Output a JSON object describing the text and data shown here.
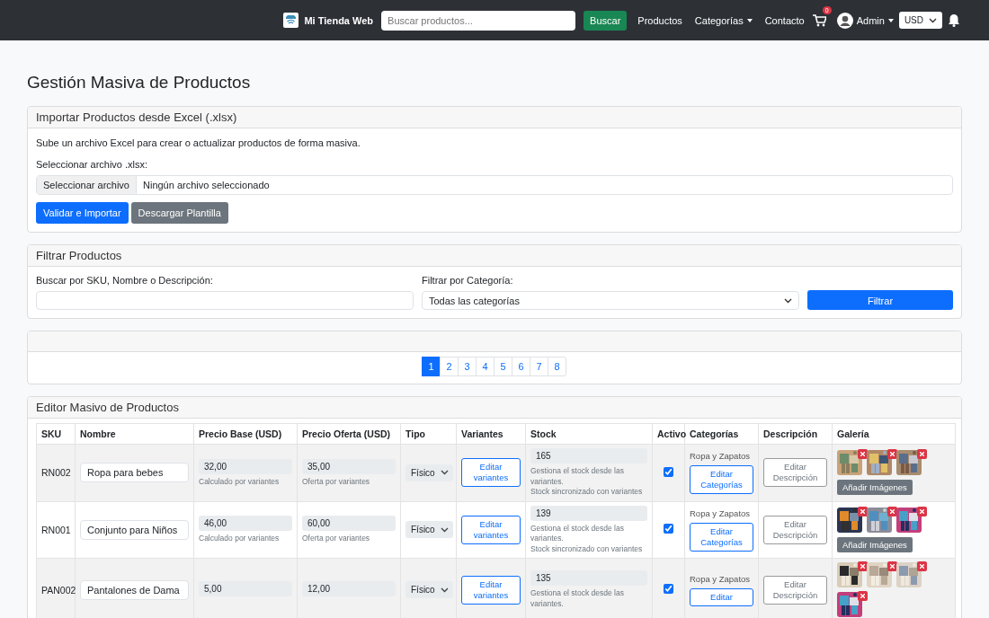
{
  "navbar": {
    "brand": "Mi Tienda Web",
    "search_placeholder": "Buscar productos...",
    "search_button": "Buscar",
    "links": [
      {
        "label": "Productos",
        "dropdown": false
      },
      {
        "label": "Categorías",
        "dropdown": true
      },
      {
        "label": "Contacto",
        "dropdown": false
      }
    ],
    "cart_count": "0",
    "user": "Admin",
    "currency": "USD"
  },
  "page_title": "Gestión Masiva de Productos",
  "import_card": {
    "title": "Importar Productos desde Excel (.xlsx)",
    "description": "Sube un archivo Excel para crear o actualizar productos de forma masiva.",
    "file_label": "Seleccionar archivo .xlsx:",
    "file_button": "Seleccionar archivo",
    "file_status": "Ningún archivo seleccionado",
    "buttons": [
      {
        "label": "Validar e Importar",
        "kind": "primary"
      },
      {
        "label": "Descargar Plantilla",
        "kind": "secondary"
      }
    ]
  },
  "filter_card": {
    "title": "Filtrar Productos",
    "search_label": "Buscar por SKU, Nombre o Descripción:",
    "category_label": "Filtrar por Categoría:",
    "category_value": "Todas las categorías",
    "button": "Filtrar"
  },
  "pagination": [
    {
      "label": "1",
      "selected": true
    },
    {
      "label": "2",
      "selected": false
    },
    {
      "label": "3",
      "selected": false
    },
    {
      "label": "4",
      "selected": false
    },
    {
      "label": "5",
      "selected": false
    },
    {
      "label": "6",
      "selected": false
    },
    {
      "label": "7",
      "selected": false
    },
    {
      "label": "8",
      "selected": false
    }
  ],
  "editor": {
    "title": "Editor Masivo de Productos",
    "columns": [
      "SKU",
      "Nombre",
      "Precio Base (USD)",
      "Precio Oferta (USD)",
      "Tipo",
      "Variantes",
      "Stock",
      "Activo",
      "Categorías",
      "Descripción",
      "Galería"
    ],
    "rows": [
      {
        "sku": "RN002",
        "name": "Ropa para bebes",
        "base_price": "32,00",
        "base_hint": "Calculado por variantes",
        "offer_price": "35,00",
        "offer_hint": "Oferta por variantes",
        "type": "Físico",
        "variants_button": "Editar variantes",
        "stock": "165",
        "stock_notes": [
          "Gestiona el stock desde las variantes.",
          "Stock sincronizado con variantes"
        ],
        "active": true,
        "categories": "Ropa y Zapatos",
        "categories_button": "Editar Categorías",
        "description_button": "Editar Descripción",
        "gallery": [
          {
            "kind": "picture"
          },
          {
            "kind": "picture"
          },
          {
            "kind": "picture"
          }
        ],
        "add_images_button": "Añadir Imágenes"
      },
      {
        "sku": "RN001",
        "name": "Conjunto para Niños",
        "base_price": "46,00",
        "base_hint": "Calculado por variantes",
        "offer_price": "60,00",
        "offer_hint": "Oferta por variantes",
        "type": "Físico",
        "variants_button": "Editar variantes",
        "stock": "139",
        "stock_notes": [
          "Gestiona el stock desde las variantes.",
          "Stock sincronizado con variantes"
        ],
        "active": true,
        "categories": "Ropa y Zapatos",
        "categories_button": "Editar Categorías",
        "description_button": "Editar Descripción",
        "gallery": [
          {
            "kind": "picture"
          },
          {
            "kind": "picture"
          },
          {
            "kind": "picture"
          }
        ],
        "add_images_button": "Añadir Imágenes"
      },
      {
        "sku": "PAN002",
        "name": "Pantalones de Dama",
        "base_price": "5,00",
        "offer_price": "12,00",
        "type": "Físico",
        "variants_button": "Editar variantes",
        "stock": "135",
        "stock_notes": [
          "Gestiona el stock desde las variantes."
        ],
        "active": true,
        "categories": "Ropa y Zapatos",
        "categories_button": "Editar",
        "description_button": "Editar Descripción",
        "gallery": [
          {
            "kind": "picture"
          },
          {
            "kind": "picture"
          },
          {
            "kind": "picture"
          },
          {
            "kind": "picture"
          }
        ]
      }
    ]
  }
}
